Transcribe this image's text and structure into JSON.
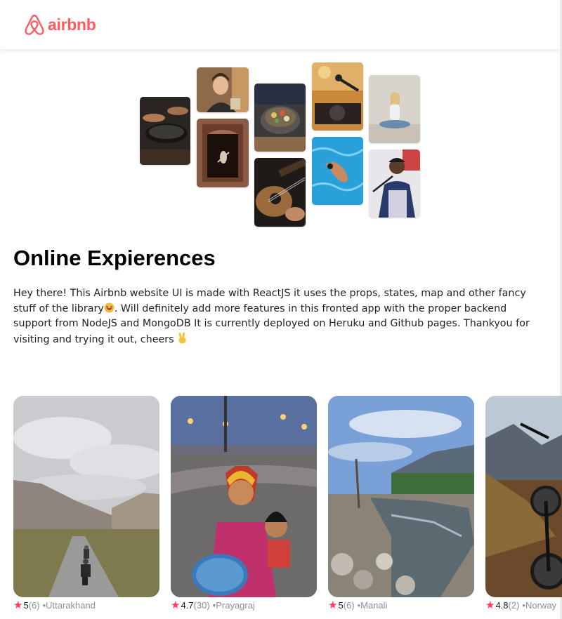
{
  "navbar": {
    "logo_text": "airbnb"
  },
  "hero": {
    "tiles": [
      {
        "name": "cooking-photo",
        "theme": "cooking"
      },
      {
        "name": "woman-portrait-photo",
        "theme": "woman-portrait"
      },
      {
        "name": "doorway-dance-photo",
        "theme": "doorway"
      },
      {
        "name": "food-bowl-photo",
        "theme": "food-bowl"
      },
      {
        "name": "guitar-photo",
        "theme": "guitar"
      },
      {
        "name": "dj-turntable-photo",
        "theme": "dj"
      },
      {
        "name": "swimmer-photo",
        "theme": "swimmer"
      },
      {
        "name": "yoga-photo",
        "theme": "yoga"
      },
      {
        "name": "singer-photo",
        "theme": "singer"
      }
    ]
  },
  "main": {
    "title": "Online Expierences",
    "description_part1": "Hey there! This Airbnb website UI is made with ReactJS it uses the props, states, map and other fancy stuff of the library",
    "description_part2": ". Will definitely add more features in this fronted app with the proper backend support from NodeJS and MongoDB It is currently deployed on Heruku and Github pages. Thankyou for visiting and trying it out, cheers "
  },
  "cards": [
    {
      "rating": "5",
      "count": "(6)",
      "separator": "•",
      "location": "Uttarakhand",
      "photo": "mountain-road-bikers"
    },
    {
      "rating": "4.7",
      "count": "(30)",
      "separator": "•",
      "location": "Prayagraj",
      "photo": "children-festival"
    },
    {
      "rating": "5",
      "count": "(6)",
      "separator": "•",
      "location": "Manali",
      "photo": "river-valley"
    },
    {
      "rating": "4.8",
      "count": "(2)",
      "separator": "•",
      "location": "Norway",
      "photo": "mountain-bicycle"
    }
  ],
  "colors": {
    "brand": "#FF5A5F",
    "star": "#FE395C",
    "muted": "#918E9B"
  }
}
